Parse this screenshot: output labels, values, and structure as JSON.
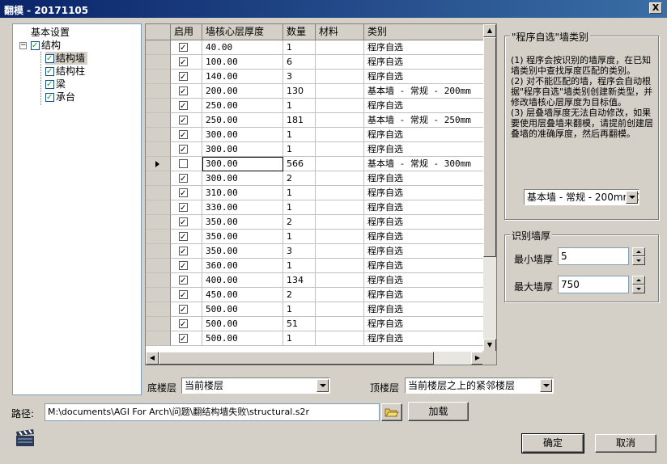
{
  "window": {
    "title": "翻模 - 20171105",
    "close_glyph": "X"
  },
  "tree": {
    "root": "基本设置",
    "group": "结构",
    "children": [
      "结构墙",
      "结构柱",
      "梁",
      "承台"
    ]
  },
  "grid": {
    "headers": [
      "启用",
      "墙核心层厚度",
      "数量",
      "材料",
      "类别"
    ],
    "rows": [
      {
        "enabled": true,
        "thickness": "40.00",
        "count": "1",
        "material": "",
        "category": "程序自选"
      },
      {
        "enabled": true,
        "thickness": "100.00",
        "count": "6",
        "material": "",
        "category": "程序自选"
      },
      {
        "enabled": true,
        "thickness": "140.00",
        "count": "3",
        "material": "",
        "category": "程序自选"
      },
      {
        "enabled": true,
        "thickness": "200.00",
        "count": "130",
        "material": "",
        "category": "基本墙 - 常规 - 200mm"
      },
      {
        "enabled": true,
        "thickness": "250.00",
        "count": "1",
        "material": "",
        "category": "程序自选"
      },
      {
        "enabled": true,
        "thickness": "250.00",
        "count": "181",
        "material": "",
        "category": "基本墙 - 常规 - 250mm"
      },
      {
        "enabled": true,
        "thickness": "300.00",
        "count": "1",
        "material": "",
        "category": "程序自选"
      },
      {
        "enabled": true,
        "thickness": "300.00",
        "count": "1",
        "material": "",
        "category": "程序自选"
      },
      {
        "enabled": false,
        "thickness": "300.00",
        "count": "566",
        "material": "",
        "category": "基本墙 - 常规 - 300mm",
        "current": true
      },
      {
        "enabled": true,
        "thickness": "300.00",
        "count": "2",
        "material": "",
        "category": "程序自选"
      },
      {
        "enabled": true,
        "thickness": "310.00",
        "count": "1",
        "material": "",
        "category": "程序自选"
      },
      {
        "enabled": true,
        "thickness": "330.00",
        "count": "1",
        "material": "",
        "category": "程序自选"
      },
      {
        "enabled": true,
        "thickness": "350.00",
        "count": "2",
        "material": "",
        "category": "程序自选"
      },
      {
        "enabled": true,
        "thickness": "350.00",
        "count": "1",
        "material": "",
        "category": "程序自选"
      },
      {
        "enabled": true,
        "thickness": "350.00",
        "count": "3",
        "material": "",
        "category": "程序自选"
      },
      {
        "enabled": true,
        "thickness": "360.00",
        "count": "1",
        "material": "",
        "category": "程序自选"
      },
      {
        "enabled": true,
        "thickness": "400.00",
        "count": "134",
        "material": "",
        "category": "程序自选"
      },
      {
        "enabled": true,
        "thickness": "450.00",
        "count": "2",
        "material": "",
        "category": "程序自选"
      },
      {
        "enabled": true,
        "thickness": "500.00",
        "count": "1",
        "material": "",
        "category": "程序自选"
      },
      {
        "enabled": true,
        "thickness": "500.00",
        "count": "51",
        "material": "",
        "category": "程序自选"
      },
      {
        "enabled": true,
        "thickness": "500.00",
        "count": "1",
        "material": "",
        "category": "程序自选"
      }
    ]
  },
  "auto_select": {
    "title": "\"程序自选\"墙类别",
    "desc": [
      "(1)  程序会按识别的墙厚度，在已知墙类别中查找厚度匹配的类别。",
      "(2)  对不能匹配的墙，程序会自动根据\"程序自选\"墙类别创建新类型，并修改墙核心层厚度为目标值。",
      "(3)  层叠墙厚度无法自动修改，如果要使用层叠墙来翻模，请提前创建层叠墙的准确厚度，然后再翻模。"
    ],
    "type_value": "基本墙 - 常规 - 200mm C"
  },
  "thickness_range": {
    "title": "识别墙厚",
    "min_label": "最小墙厚",
    "min_value": "5",
    "max_label": "最大墙厚",
    "max_value": "750"
  },
  "floors": {
    "bottom_label": "底楼层",
    "bottom_value": "当前楼层",
    "top_label": "顶楼层",
    "top_value": "当前楼层之上的紧邻楼层"
  },
  "path": {
    "label": "路径:",
    "value": "M:\\documents\\AGI For Arch\\问题\\翻结构墙失败\\structural.s2r",
    "load_label": "加载"
  },
  "actions": {
    "ok": "确定",
    "cancel": "取消"
  }
}
